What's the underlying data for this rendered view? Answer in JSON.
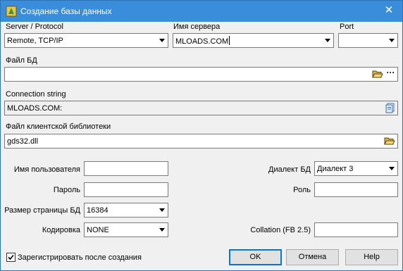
{
  "window": {
    "title": "Создание базы данных"
  },
  "protocol": {
    "label": "Server / Protocol",
    "value": "Remote, TCP/IP"
  },
  "server": {
    "label": "Имя сервера",
    "value": "MLOADS.COM"
  },
  "port": {
    "label": "Port",
    "value": ""
  },
  "db_file": {
    "label": "Файл БД",
    "value": "",
    "browse_icon": "folder-open-icon",
    "more_label": "···"
  },
  "connection": {
    "label": "Connection string",
    "value": "MLOADS.COM:",
    "copy_icon": "copy-icon"
  },
  "client_lib": {
    "label": "Файл клиентской библиотеки",
    "value": "gds32.dll",
    "browse_icon": "folder-open-icon"
  },
  "user": {
    "label": "Имя пользователя",
    "value": ""
  },
  "password": {
    "label": "Пароль",
    "value": ""
  },
  "page_size": {
    "label": "Размер страницы БД",
    "value": "16384"
  },
  "charset": {
    "label": "Кодировка",
    "value": "NONE"
  },
  "dialect": {
    "label": "Диалект БД",
    "value": "Диалект 3"
  },
  "role": {
    "label": "Роль",
    "value": ""
  },
  "collation": {
    "label": "Collation (FB 2.5)",
    "value": ""
  },
  "register": {
    "label": "Зарегистрировать после создания",
    "checked": true
  },
  "buttons": {
    "ok": "OK",
    "cancel": "Отмена",
    "help": "Help"
  },
  "colors": {
    "titlebar": "#3a8ddb",
    "default_button_border": "#0078d7"
  }
}
